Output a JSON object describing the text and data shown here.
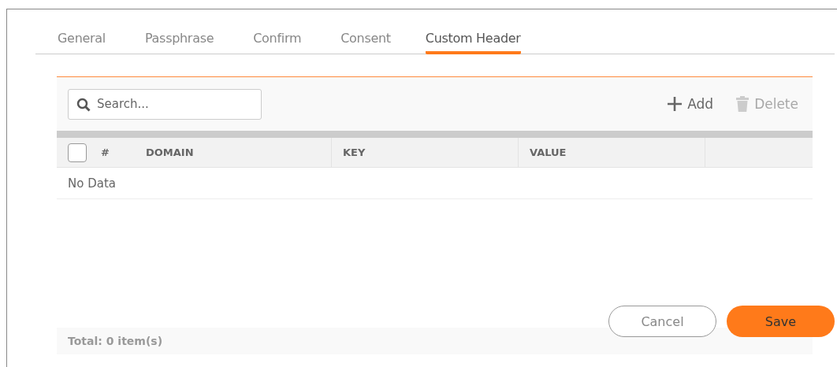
{
  "tabs": [
    {
      "label": "General",
      "selected": false
    },
    {
      "label": "Passphrase",
      "selected": false
    },
    {
      "label": "Confirm",
      "selected": false
    },
    {
      "label": "Consent",
      "selected": false
    },
    {
      "label": "Custom Header",
      "selected": true
    }
  ],
  "toolbar": {
    "search": {
      "placeholder": "Search..."
    },
    "actions": [
      {
        "kind": "add",
        "label": "Add",
        "disabled": false
      },
      {
        "kind": "delete",
        "label": "Delete",
        "disabled": true
      }
    ]
  },
  "table": {
    "select_all": {
      "checked": false
    },
    "columns": [
      "#",
      "DOMAIN",
      "KEY",
      "VALUE"
    ],
    "empty_message": "No Data"
  },
  "footer": {
    "total": "Total: 0 item(s)"
  },
  "buttons": [
    {
      "kind": "secondary",
      "label": "Cancel"
    },
    {
      "kind": "primary",
      "label": "Save"
    }
  ]
}
